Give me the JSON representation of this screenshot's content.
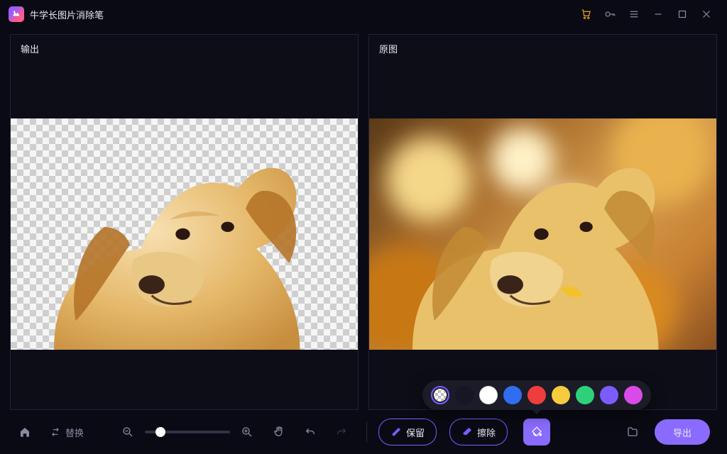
{
  "app_title": "牛学长图片消除笔",
  "panes": {
    "output": "输出",
    "original": "原图"
  },
  "toolbar": {
    "swap": "替换",
    "keep": "保留",
    "erase": "擦除",
    "export": "导出"
  },
  "zoom": {
    "value": 18
  },
  "color_picker": {
    "selected": 0,
    "swatches": [
      "transparent",
      "#161624",
      "#ffffff",
      "#2f6ef0",
      "#ef3d3d",
      "#f6cb3e",
      "#2ed17a",
      "#7c5cff",
      "#d94be8"
    ]
  }
}
